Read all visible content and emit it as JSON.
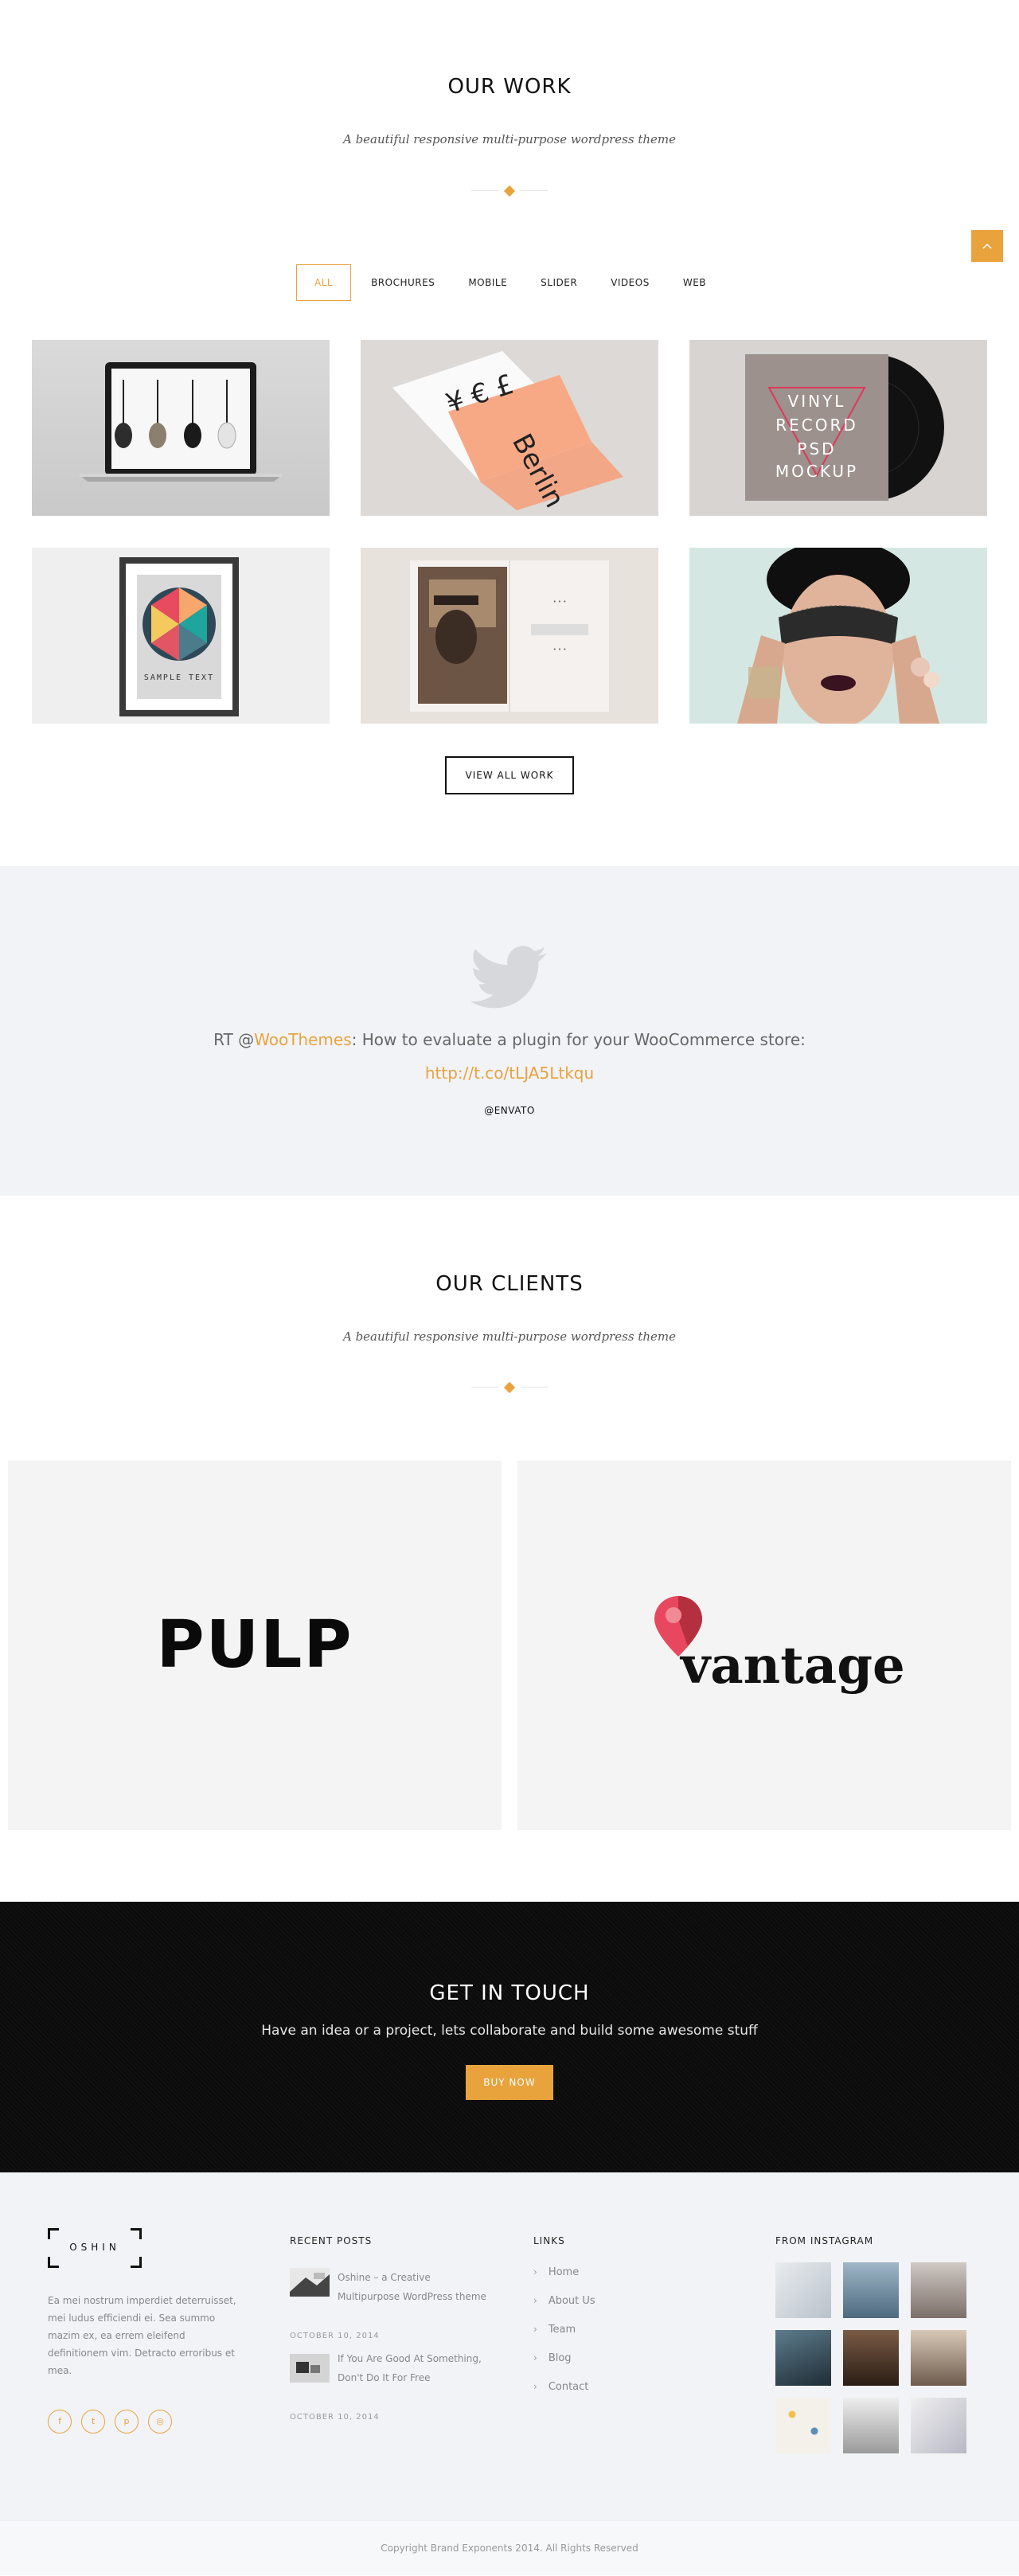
{
  "work": {
    "title": "OUR WORK",
    "subtitle": "A beautiful responsive multi-purpose wordpress theme",
    "scroll_top_icon": "chevron-up-icon",
    "filters": [
      "ALL",
      "BROCHURES",
      "MOBILE",
      "SLIDER",
      "VIDEOS",
      "WEB"
    ],
    "active_filter": "ALL",
    "tiles": [
      {
        "subject": "laptop-headphones"
      },
      {
        "subject": "berlin-brochure",
        "text": "Berlin"
      },
      {
        "subject": "vinyl-record-mockup",
        "text": "VINYL RECORD PSD MOCKUP"
      },
      {
        "subject": "framed-poster",
        "text": "SAMPLE TEXT"
      },
      {
        "subject": "open-book"
      },
      {
        "subject": "lace-blindfold-portrait"
      }
    ],
    "view_all_label": "VIEW ALL WORK"
  },
  "twitter": {
    "icon": "twitter-bird-icon",
    "tweet_prefix": "RT @",
    "tweet_handle": "WooThemes",
    "tweet_text": ": How to evaluate a plugin for your WooCommerce store:",
    "tweet_link": "http://t.co/tLJA5Ltkqu",
    "author": "@ENVATO"
  },
  "clients": {
    "title": "OUR CLIENTS",
    "subtitle": "A beautiful responsive multi-purpose wordpress theme",
    "logos": [
      {
        "name": "PULP"
      },
      {
        "name": "vantage"
      }
    ]
  },
  "cta": {
    "title": "GET IN TOUCH",
    "text": "Have an idea or a project, lets collaborate and build some awesome stuff",
    "button": "BUY NOW"
  },
  "footer": {
    "logo": "OSHIN",
    "about": "Ea mei nostrum imperdiet deterruisset, mei ludus efficiendi ei. Sea summo mazim ex, ea errem eleifend definitionem vim. Detracto erroribus et mea.",
    "social": [
      "facebook-icon",
      "twitter-icon",
      "pinterest-icon",
      "dribbble-icon"
    ],
    "recent_posts_title": "RECENT POSTS",
    "posts": [
      {
        "title": "Oshine – a Creative Multipurpose WordPress theme",
        "date": "OCTOBER 10, 2014"
      },
      {
        "title": "If You Are Good At Something, Don't Do It For Free",
        "date": "OCTOBER 10, 2014"
      }
    ],
    "links_title": "LINKS",
    "links": [
      "Home",
      "About Us",
      "Team",
      "Blog",
      "Contact"
    ],
    "instagram_title": "FROM INSTAGRAM"
  },
  "copyright": "Copyright Brand Exponents 2014. All Rights Reserved",
  "colors": {
    "accent": "#e8a33d",
    "dark": "#0b0b0b",
    "light_bg": "#f2f3f7"
  }
}
